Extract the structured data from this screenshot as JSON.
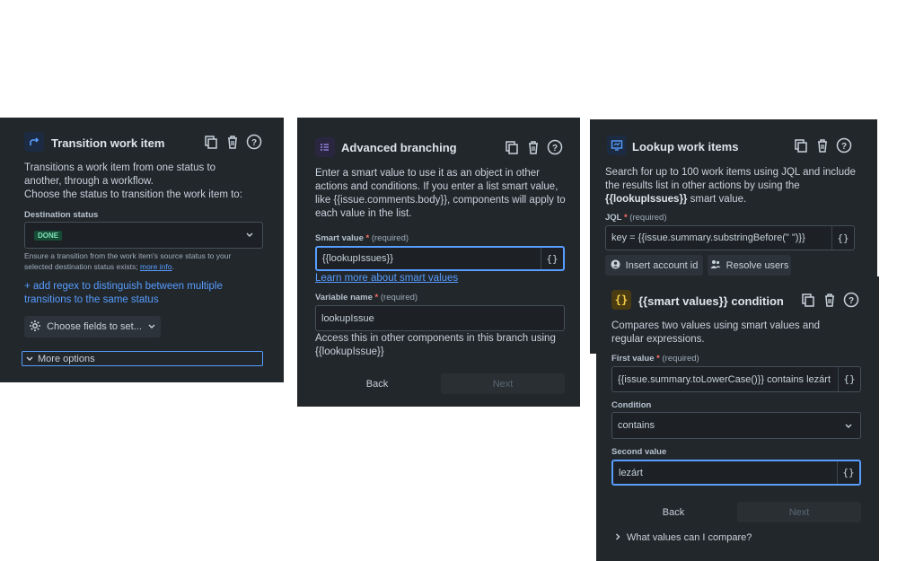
{
  "panel1": {
    "title": "Transition work item",
    "description_1": "Transitions a work item from one status to another, through a workflow.",
    "description_2": "Choose the status to transition the work item to:",
    "destination_label": "Destination status",
    "destination_value": "DONE",
    "hint": "Ensure a transition from the work item's source status to your selected destination status exists;",
    "hint_link": "more info",
    "regex_link": "+ add regex to distinguish between multiple transitions to the same status",
    "choose_fields": "Choose fields to set...",
    "more_options": "More options"
  },
  "panel2": {
    "title": "Advanced branching",
    "description": "Enter a smart value to use it as an object in other actions and conditions. If you enter a list smart value, like {{issue.comments.body}}, components will apply to each value in the list.",
    "smart_label": "Smart value",
    "required_text": "(required)",
    "smart_value": "{{lookupIssues}}",
    "learn_more": "Learn more about smart values",
    "var_label": "Variable name",
    "var_value": "lookupIssue",
    "access_text": "Access this in other components in this branch using {{lookupIssue}}",
    "back": "Back",
    "next": "Next"
  },
  "panel3": {
    "title": "Lookup work items",
    "description_pre": "Search for up to 100 work items using JQL and include the results list in other actions by using the",
    "description_bold": "{{lookupIssues}}",
    "description_post": "smart value.",
    "jql_label": "JQL",
    "required_text": "(required)",
    "jql_value": "key = {{issue.summary.substringBefore(\" \")}}",
    "insert_account": "Insert account id",
    "resolve_users": "Resolve users"
  },
  "panel4": {
    "title": "{{smart values}} condition",
    "description": "Compares two values using smart values and regular expressions.",
    "first_label": "First value",
    "required_text": "(required)",
    "first_value": "{{issue.summary.toLowerCase()}} contains lezárt",
    "condition_label": "Condition",
    "condition_value": "contains",
    "second_label": "Second value",
    "second_value": "lezárt",
    "back": "Back",
    "next": "Next",
    "compare_link": "What values can I compare?"
  },
  "braces": "{}",
  "colors": {
    "panel_bg": "#22272b",
    "accent": "#579dff",
    "done_lozenge": "#164b35",
    "required": "#f87168"
  }
}
